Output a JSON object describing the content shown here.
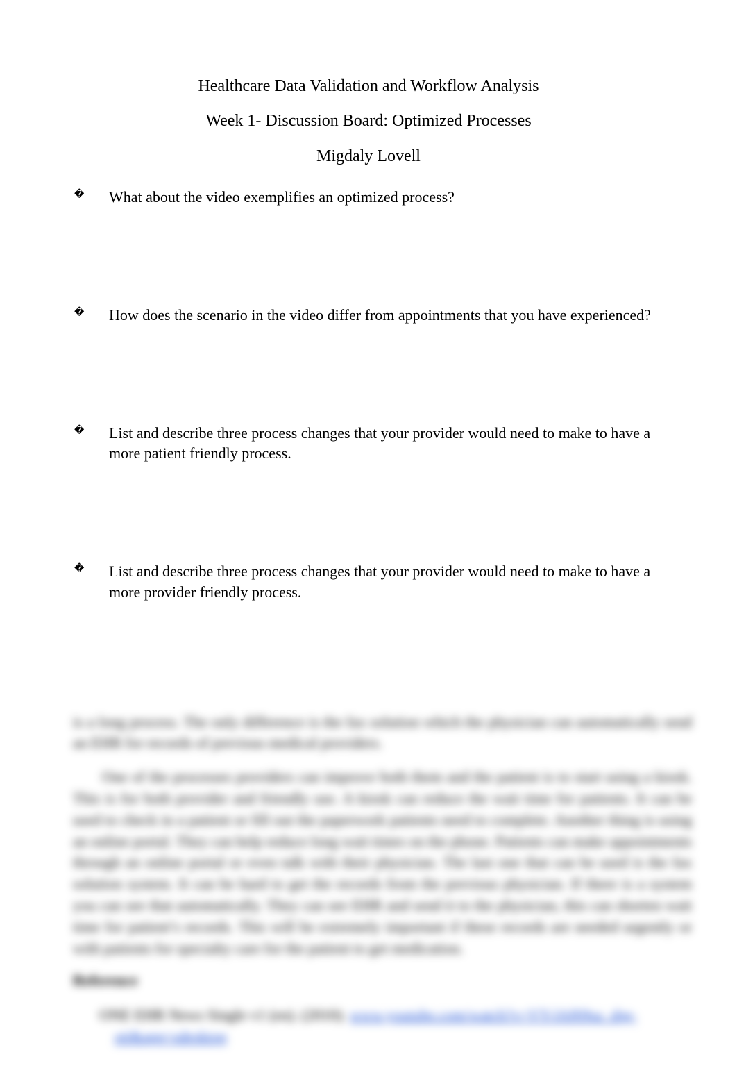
{
  "title_line_1": "Healthcare Data Validation and Workflow Analysis",
  "title_line_2": "Week 1- Discussion Board: Optimized Processes",
  "author": "Migdaly Lovell",
  "bullets": [
    {
      "text": "What about the video exemplifies an optimized process?"
    },
    {
      "text": "How does the scenario in the video differ from appointments that you have experienced?"
    },
    {
      "text": "List and describe three process changes that your provider would need to make to have a more patient friendly process."
    },
    {
      "text": "List and describe three process changes that your provider would need to make to have a more provider friendly process."
    }
  ],
  "blurred": {
    "frag1": "is a long process. The only difference is the fax solution which the physician can automatically send an EHR for records of previous medical providers.",
    "frag2": "One of the processes providers can improve both them and the patient is to start using a kiosk. This is for both provider and friendly use. A kiosk can reduce the wait time for patients. It can be used to check in a patient or fill out the paperwork patients need to complete. Another thing is using an online portal. They can help reduce long wait times on the phone. Patients can make appointments through an online portal or even talk with their physician. The last one that can be used is the fax solution system. It can be hard to get the records from the previous physician. If there is a system you can see that automatically. They can see EHR and send it to the physician, this can shorten wait time for patient’s records. This will be extremely important if these records are needed urgently or with patients for specialty care for the patient to get medication.",
    "ref_title": "Reference",
    "ref_text": "ONE EHR News Single v1 (en). (2010).",
    "ref_link": "www.youtube.com/watch?v=VY-lAf69sa_sbg-oti&app=sdesktop"
  }
}
